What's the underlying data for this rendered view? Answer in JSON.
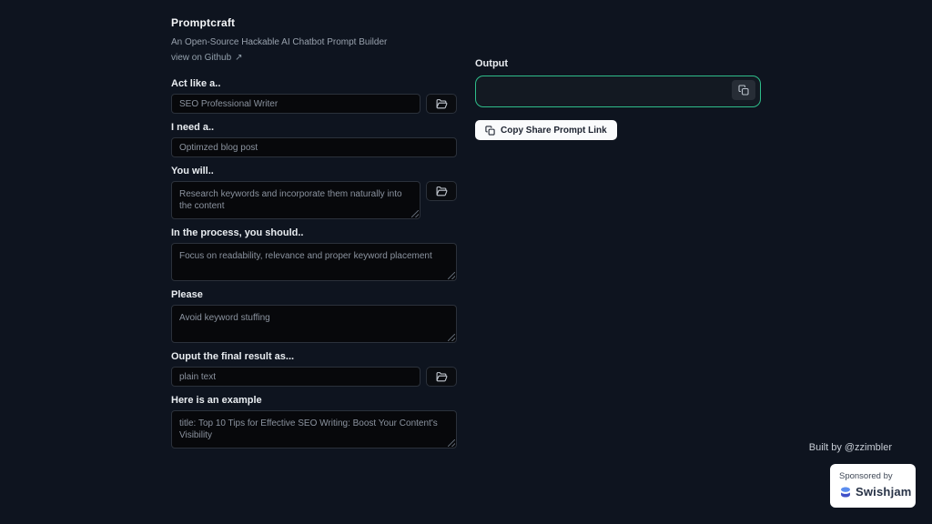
{
  "app": {
    "title": "Promptcraft",
    "subtitle": "An Open-Source Hackable AI Chatbot Prompt Builder",
    "github_link_label": "view on Github",
    "github_arrow": "↗"
  },
  "form": {
    "fields": [
      {
        "label": "Act like a..",
        "value": "SEO Professional Writer",
        "type": "input",
        "has_folder_button": true
      },
      {
        "label": "I need a..",
        "value": "Optimzed blog post",
        "type": "input",
        "has_folder_button": false
      },
      {
        "label": "You will..",
        "value": "Research keywords and incorporate them naturally into the content",
        "type": "textarea",
        "has_folder_button": true
      },
      {
        "label": "In the process, you should..",
        "value": "Focus on readability, relevance and proper keyword placement",
        "type": "textarea",
        "has_folder_button": false
      },
      {
        "label": "Please",
        "value": "Avoid keyword stuffing",
        "type": "textarea",
        "has_folder_button": false
      },
      {
        "label": "Ouput the final result as...",
        "value": "plain text",
        "type": "input",
        "has_folder_button": true
      },
      {
        "label": "Here is an example",
        "value": "title: Top 10 Tips for Effective SEO Writing: Boost Your Content's Visibility",
        "type": "textarea",
        "has_folder_button": false
      }
    ]
  },
  "output": {
    "label": "Output",
    "value": "",
    "copy_share_label": "Copy Share Prompt Link"
  },
  "footer": {
    "built_by": "Built by @zzimbler",
    "sponsored_by": "Sponsored by",
    "sponsor_name": "Swishjam"
  },
  "icons": {
    "folder": "folder-open-icon",
    "copy": "copy-icon",
    "external_arrow": "arrow-up-right-icon",
    "sponsor_logo": "swishjam-logo-icon"
  },
  "colors": {
    "background": "#0e141f",
    "field_background": "#07080b",
    "accent_green": "#2ebd8a",
    "button_white": "#fafbfc",
    "sponsor_blue_top": "#5b8def",
    "sponsor_blue_bottom": "#4050c8"
  }
}
